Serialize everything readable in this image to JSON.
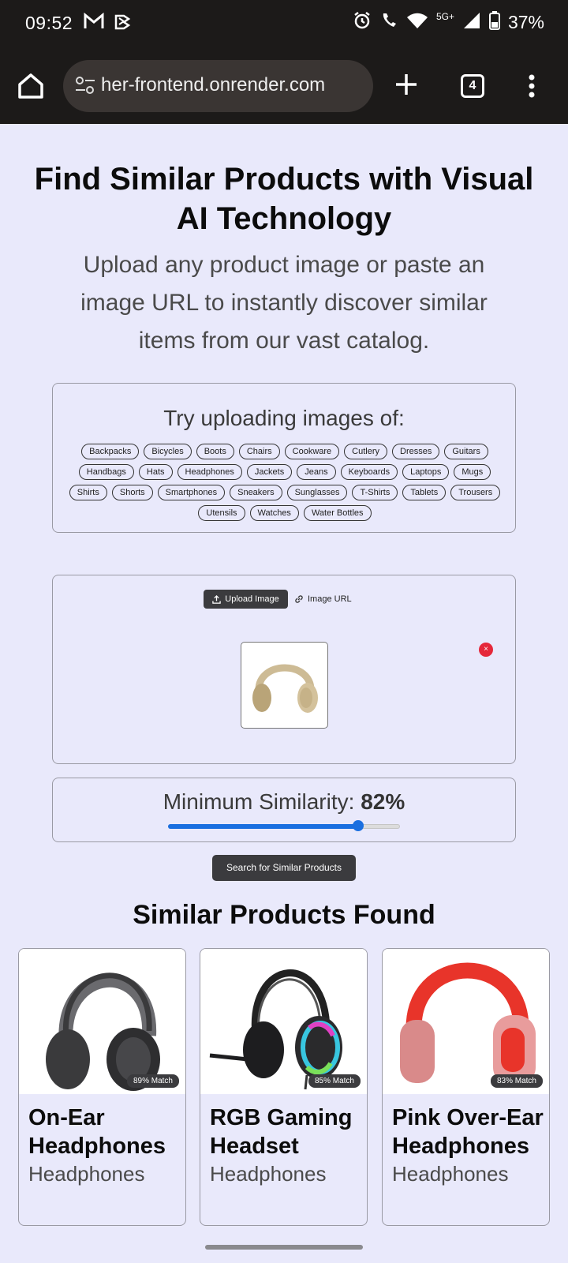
{
  "status_bar": {
    "time": "09:52",
    "network": "5G+",
    "battery": "37%"
  },
  "browser": {
    "url": "her-frontend.onrender.com",
    "tab_count": "4"
  },
  "hero": {
    "title": "Find Similar Products with Visual AI Technology",
    "subtitle": "Upload any product image or paste an image URL to instantly discover similar items from our vast catalog."
  },
  "suggestions": {
    "title": "Try uploading images of:",
    "chips": [
      "Backpacks",
      "Bicycles",
      "Boots",
      "Chairs",
      "Cookware",
      "Cutlery",
      "Dresses",
      "Guitars",
      "Handbags",
      "Hats",
      "Headphones",
      "Jackets",
      "Jeans",
      "Keyboards",
      "Laptops",
      "Mugs",
      "Shirts",
      "Shorts",
      "Smartphones",
      "Sneakers",
      "Sunglasses",
      "T-Shirts",
      "Tablets",
      "Trousers",
      "Utensils",
      "Watches",
      "Water Bottles"
    ]
  },
  "upload": {
    "upload_tab": "Upload Image",
    "url_tab": "Image URL",
    "remove": "×"
  },
  "similarity": {
    "label": "Minimum Similarity:",
    "value_text": "82%",
    "value": 0.82
  },
  "search_button": "Search for Similar Products",
  "results": {
    "title": "Similar Products Found",
    "items": [
      {
        "name": "On-Ear Headphones",
        "category": "Headphones",
        "match": "89% Match"
      },
      {
        "name": "RGB Gaming Headset",
        "category": "Headphones",
        "match": "85% Match"
      },
      {
        "name": "Pink Over-Ear Headphones",
        "category": "Headphones",
        "match": "83% Match"
      }
    ]
  },
  "colors": {
    "page_bg": "#e9e9fb",
    "accent": "#1a6fe0",
    "dark_button": "#3b3b3e",
    "remove_red": "#e5283a"
  }
}
